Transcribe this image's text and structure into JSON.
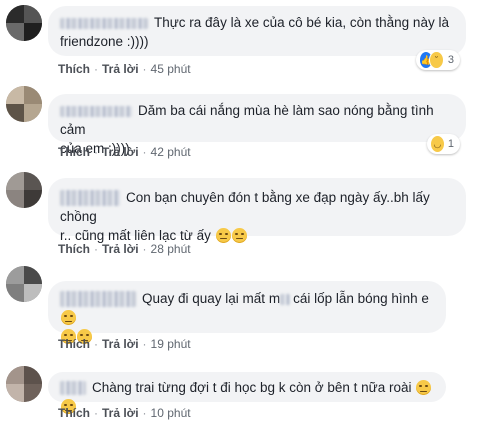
{
  "comments": [
    {
      "text": "Thực ra đây là xe của cô bé kia, còn thằng này là friendzone :))))",
      "line1": "Thực ra đây là xe của cô bé kia, còn thằng này là",
      "line2": "friendzone :))))",
      "actions": {
        "like": "Thích",
        "reply": "Trả lời",
        "time": "45 phút"
      },
      "reactions": {
        "icons": [
          "like-icon",
          "sad-icon"
        ],
        "count": "3"
      }
    },
    {
      "text": "Dăm ba cái nắng mùa hè làm sao nóng bằng tình cảm của em :))))",
      "line1": "Dăm ba cái nắng mùa hè làm sao nóng bằng tình cảm",
      "line2": "của em :))))",
      "actions": {
        "like": "Thích",
        "reply": "Trả lời",
        "time": "42 phút"
      },
      "reactions": {
        "icons": [
          "haha-icon"
        ],
        "count": "1"
      }
    },
    {
      "text": "Con bạn chuyên đón t bằng xe đạp ngày ấy..bh lấy chồng r.. cũng mất liên lạc từ ấy",
      "line1": "Con bạn chuyên đón t bằng xe đạp ngày ấy..bh lấy chồng",
      "line2": "r.. cũng mất liên lạc từ ấy",
      "emojis": [
        "sad-face-emoji",
        "sad-face-emoji"
      ],
      "actions": {
        "like": "Thích",
        "reply": "Trả lời",
        "time": "28 phút"
      }
    },
    {
      "text": "Quay đi quay lại mất mẹ cái lốp lẫn bóng hình e",
      "line1a": "Quay đi quay lại mất m",
      "line1b": "cái lốp lẫn bóng hình e",
      "emojis": [
        "neutral-face-emoji",
        "neutral-face-emoji",
        "neutral-face-emoji"
      ],
      "actions": {
        "like": "Thích",
        "reply": "Trả lời",
        "time": "19 phút"
      }
    },
    {
      "text": "Chàng trai từng đợi t đi học bg k còn ở bên t nữa roài",
      "line1": "Chàng trai từng đợi t đi học bg k còn ở bên t nữa roài",
      "emojis": [
        "unamused-face-emoji",
        "unamused-face-emoji"
      ],
      "actions": {
        "like": "Thích",
        "reply": "Trả lời",
        "time": "10 phút"
      }
    }
  ],
  "colors": {
    "bubble": "#f2f3f5",
    "link": "#4b4f56",
    "text": "#1d2129",
    "like_blue": "#2078f4",
    "emoji_yellow": "#f7c948"
  }
}
